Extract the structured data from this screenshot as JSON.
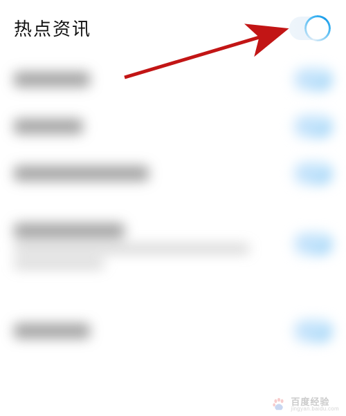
{
  "header": {
    "title": "热点资讯"
  },
  "toggles": {
    "main_on": true
  },
  "annotation": {
    "type": "arrow",
    "color": "#c21515"
  },
  "watermark": {
    "brand_cn": "百度经验",
    "brand_en": "jingyan.baidu.com"
  }
}
